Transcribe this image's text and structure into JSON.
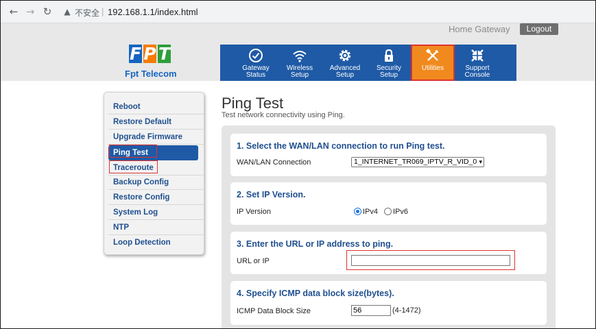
{
  "browser": {
    "back_icon": "←",
    "forward_icon": "→",
    "reload_icon": "↻",
    "security_icon": "▲",
    "security_label": "不安全",
    "separator": "|",
    "url": "192.168.1.1/index.html"
  },
  "header": {
    "home_gateway": "Home Gateway",
    "logout": "Logout",
    "logo": {
      "f": "F",
      "p": "P",
      "t": "T",
      "name": "Fpt Telecom"
    }
  },
  "nav": [
    {
      "line1": "Gateway",
      "line2": "Status",
      "icon": "check-circle-icon"
    },
    {
      "line1": "Wireless",
      "line2": "Setup",
      "icon": "wifi-icon"
    },
    {
      "line1": "Advanced",
      "line2": "Setup",
      "icon": "gear-icon"
    },
    {
      "line1": "Security",
      "line2": "Setup",
      "icon": "lock-icon"
    },
    {
      "line1": "Utilities",
      "line2": "",
      "icon": "tools-icon",
      "active": true
    },
    {
      "line1": "Support",
      "line2": "Console",
      "icon": "arrows-collapse-icon"
    }
  ],
  "sidebar": {
    "items": [
      "Reboot",
      "Restore Default",
      "Upgrade Firmware",
      "Ping Test",
      "Traceroute",
      "Backup Config",
      "Restore Config",
      "System Log",
      "NTP",
      "Loop Detection"
    ],
    "active_index": 3
  },
  "main": {
    "title": "Ping Test",
    "subtitle": "Test network connectivity using Ping.",
    "section1": {
      "title": "1. Select the WAN/LAN connection to run Ping test.",
      "label": "WAN/LAN Connection",
      "selected": "1_INTERNET_TR069_IPTV_R_VID_0",
      "chevron": "▾"
    },
    "section2": {
      "title": "2. Set IP Version.",
      "label": "IP Version",
      "option_ipv4": "IPv4",
      "option_ipv6": "IPv6",
      "selected": "IPv4"
    },
    "section3": {
      "title": "3. Enter the URL or IP address to ping.",
      "label": "URL or IP",
      "value": ""
    },
    "section4": {
      "title": "4. Specify ICMP data block size(bytes).",
      "label": "ICMP Data Block Size",
      "value": "56",
      "range": "(4-1472)"
    }
  },
  "colors": {
    "nav_blue": "#1f5aa6",
    "active_orange": "#f08a1e",
    "highlight_red": "#e03030",
    "link_blue": "#1f4f8f"
  }
}
